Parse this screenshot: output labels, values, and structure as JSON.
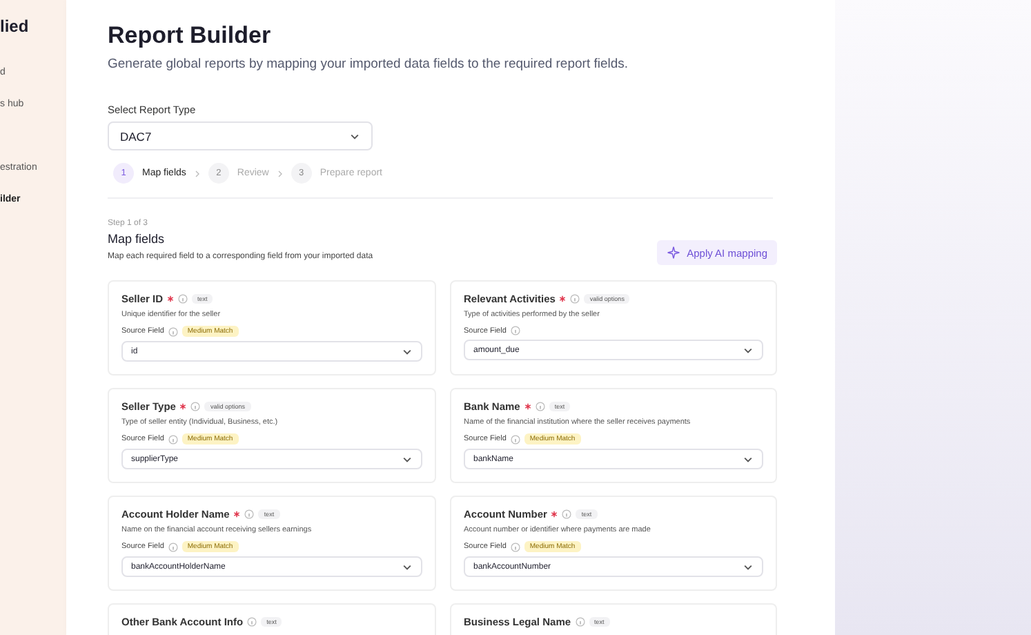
{
  "sidebar": {
    "logo": "lied",
    "items": [
      {
        "label": "d",
        "selected": false
      },
      {
        "label": "s hub",
        "selected": false
      },
      {
        "label": "estration",
        "selected": false
      },
      {
        "label": "ilder",
        "selected": true
      }
    ]
  },
  "header": {
    "title": "Report Builder",
    "subtitle": "Generate global reports by mapping your imported data fields to the required report fields."
  },
  "report_type": {
    "label": "Select Report Type",
    "value": "DAC7"
  },
  "steps": [
    {
      "number": "1",
      "label": "Map fields",
      "selected": true
    },
    {
      "number": "2",
      "label": "Review",
      "selected": false
    },
    {
      "number": "3",
      "label": "Prepare report",
      "selected": false
    }
  ],
  "section": {
    "step_caption": "Step 1 of 3",
    "title": "Map fields",
    "description": "Map each required field to a corresponding field from your imported data",
    "ai_button": "Apply AI mapping"
  },
  "fields": [
    {
      "name": "Seller ID",
      "required": true,
      "tag": "text",
      "description": "Unique identifier for the seller",
      "source_label": "Source Field",
      "match": "Medium Match",
      "value": "id"
    },
    {
      "name": "Relevant Activities",
      "required": true,
      "tag": "valid options",
      "description": "Type of activities performed by the seller",
      "source_label": "Source Field",
      "value": "amount_due"
    },
    {
      "name": "Seller Type",
      "required": true,
      "tag": "valid options",
      "description": "Type of seller entity (Individual, Business, etc.)",
      "source_label": "Source Field",
      "match": "Medium Match",
      "value": "supplierType"
    },
    {
      "name": "Bank Name",
      "required": true,
      "tag": "text",
      "description": "Name of the financial institution where the seller receives payments",
      "source_label": "Source Field",
      "match": "Medium Match",
      "value": "bankName"
    },
    {
      "name": "Account Holder Name",
      "required": true,
      "tag": "text",
      "description": "Name on the financial account receiving sellers earnings",
      "source_label": "Source Field",
      "match": "Medium Match",
      "value": "bankAccountHolderName"
    },
    {
      "name": "Account Number",
      "required": true,
      "tag": "text",
      "description": "Account number or identifier where payments are made",
      "source_label": "Source Field",
      "match": "Medium Match",
      "value": "bankAccountNumber"
    },
    {
      "name": "Other Bank Account Info",
      "required": false,
      "tag": "text"
    },
    {
      "name": "Business Legal Name",
      "required": false,
      "tag": "text"
    }
  ]
}
